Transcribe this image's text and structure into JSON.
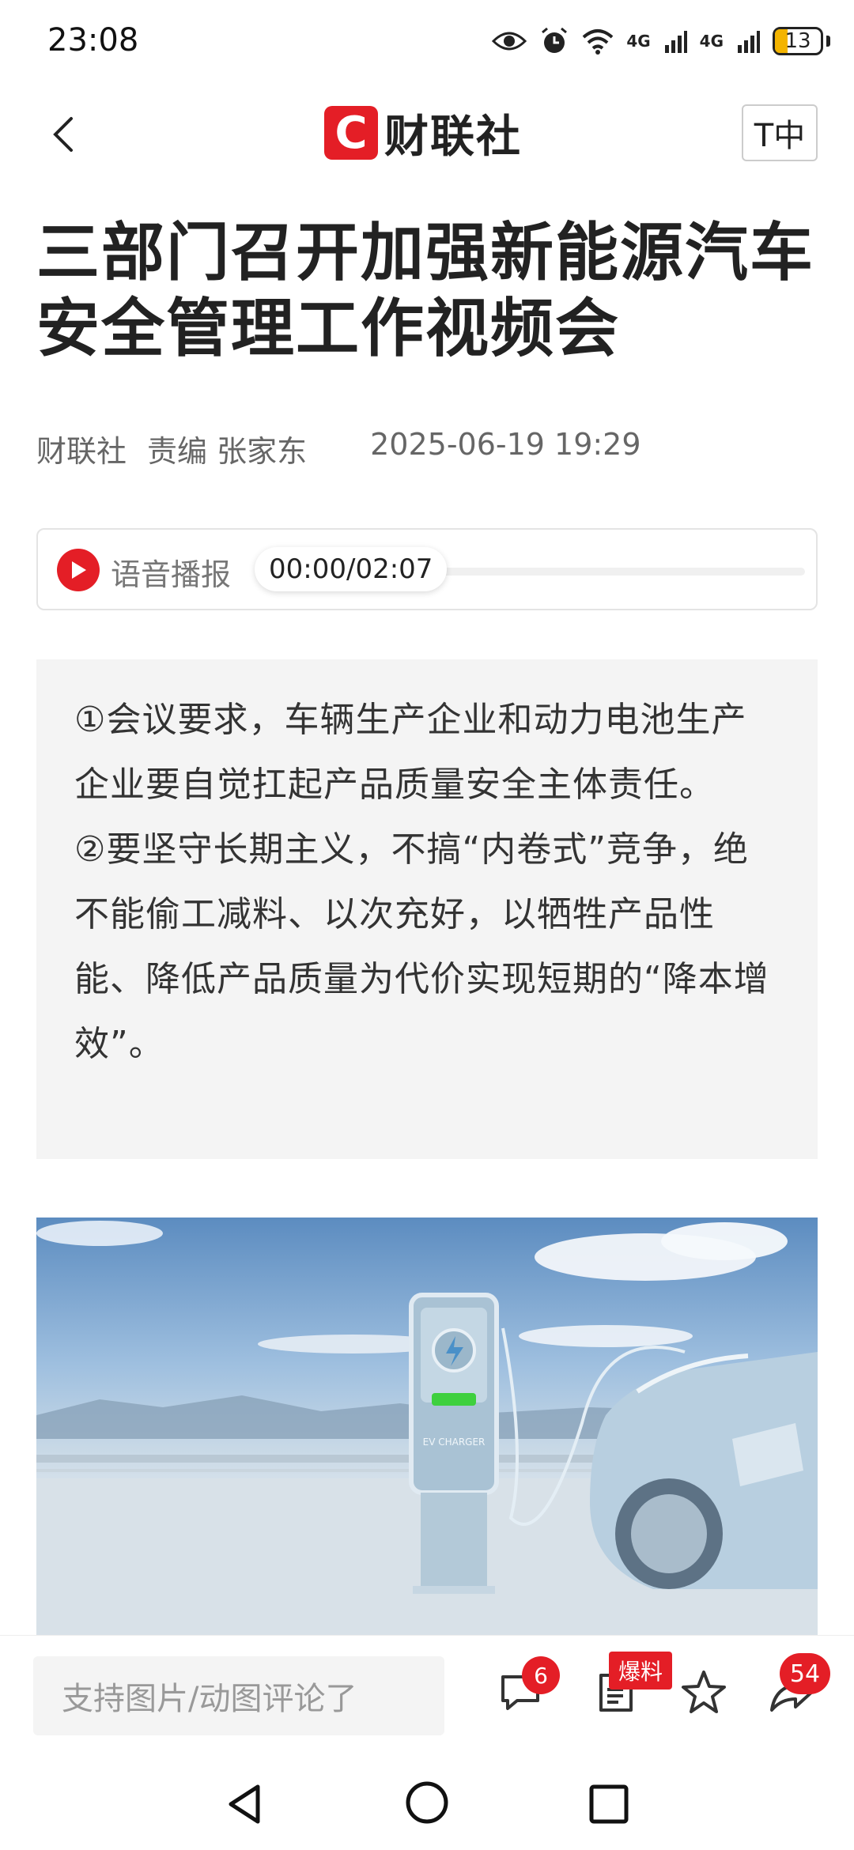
{
  "status": {
    "time": "23:08",
    "network_1": "4G",
    "network_2": "4G",
    "battery": "13"
  },
  "header": {
    "logo_mark": "C",
    "logo_text": "财联社",
    "font_size_button": "T中"
  },
  "article": {
    "title": "三部门召开加强新能源汽车安全管理工作视频会",
    "source": "财联社",
    "editor": "责编 张家东",
    "date": "2025-06-19 19:29"
  },
  "audio": {
    "label": "语音播报",
    "time": "00:00/02:07",
    "progress": 0
  },
  "summary": {
    "point_1": "①会议要求，车辆生产企业和动力电池生产企业要自觉扛起产品质量安全主体责任。",
    "point_2": "②要坚守长期主义，不搞“内卷式”竞争，绝不能偷工减料、以次充好，以牺牲产品性能、降低产品质量为代价实现短期的“降本增效”。"
  },
  "image": {
    "charger_text": "EV CHARGER"
  },
  "bottom_bar": {
    "comment_placeholder": "支持图片/动图评论了",
    "comment_count": "6",
    "report_label": "爆料",
    "share_count": "54"
  },
  "colors": {
    "brand": "#e41e26",
    "summary_bg": "#f4f4f4"
  }
}
